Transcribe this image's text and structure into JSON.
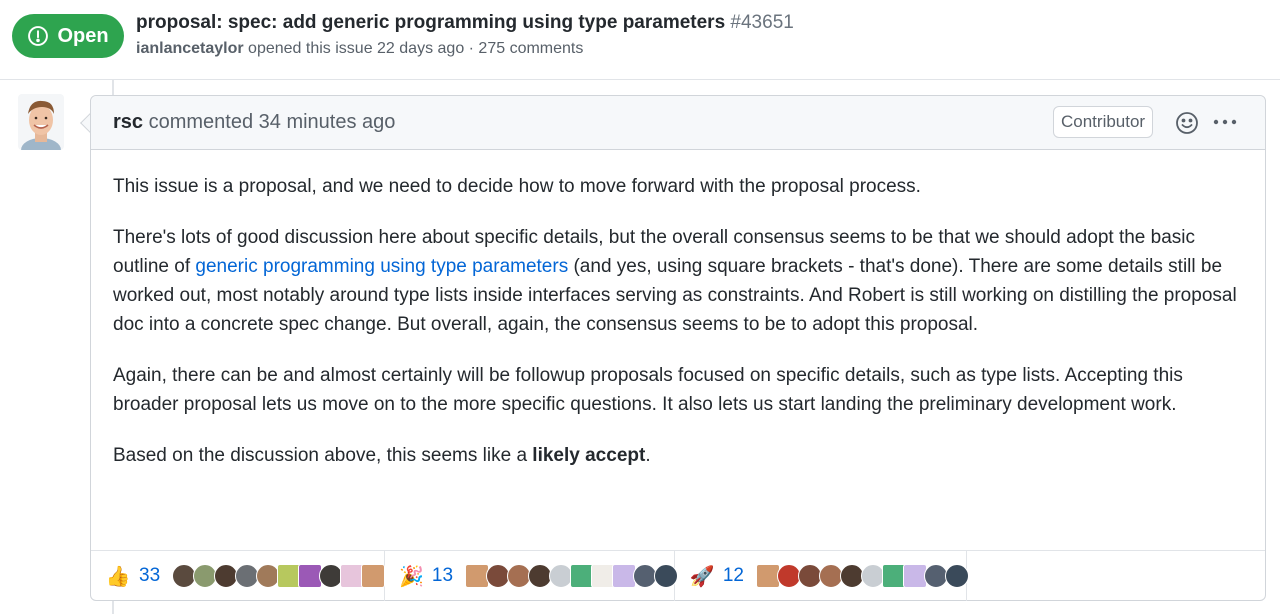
{
  "issue": {
    "state": "Open",
    "title": "proposal: spec: add generic programming using type parameters",
    "number": "#43651",
    "author": "ianlancetaylor",
    "meta_text": " opened this issue 22 days ago · 275 comments"
  },
  "comment": {
    "author": "rsc",
    "action_text": " commented 34 minutes ago",
    "role": "Contributor",
    "icons": [
      "smiley-icon",
      "kebab-horizontal-icon"
    ],
    "paragraphs": {
      "p1": "This issue is a proposal, and we need to decide how to move forward with the proposal process.",
      "p2_before": "There's lots of good discussion here about specific details, but the overall consensus seems to be that we should adopt the basic outline of ",
      "p2_link": "generic programming using type parameters",
      "p2_after": " (and yes, using square brackets - that's done). There are some details still be worked out, most notably around type lists inside interfaces serving as constraints. And Robert is still working on distilling the proposal doc into a concrete spec change. But overall, again, the consensus seems to be to adopt this proposal.",
      "p3": "Again, there can be and almost certainly will be followup proposals focused on specific details, such as type lists. Accepting this broader proposal lets us move on to the more specific questions. It also lets us start landing the preliminary development work.",
      "p4_before": "Based on the discussion above, this seems like a ",
      "p4_bold": "likely accept",
      "p4_after": "."
    }
  },
  "reactions": [
    {
      "emoji": "👍",
      "count": "33"
    },
    {
      "emoji": "🎉",
      "count": "13"
    },
    {
      "emoji": "🚀",
      "count": "12"
    }
  ],
  "colors": {
    "open_green": "#2ea44f",
    "link_blue": "#0366d6",
    "border": "#d1d5da",
    "header_bg": "#f6f8fa"
  }
}
